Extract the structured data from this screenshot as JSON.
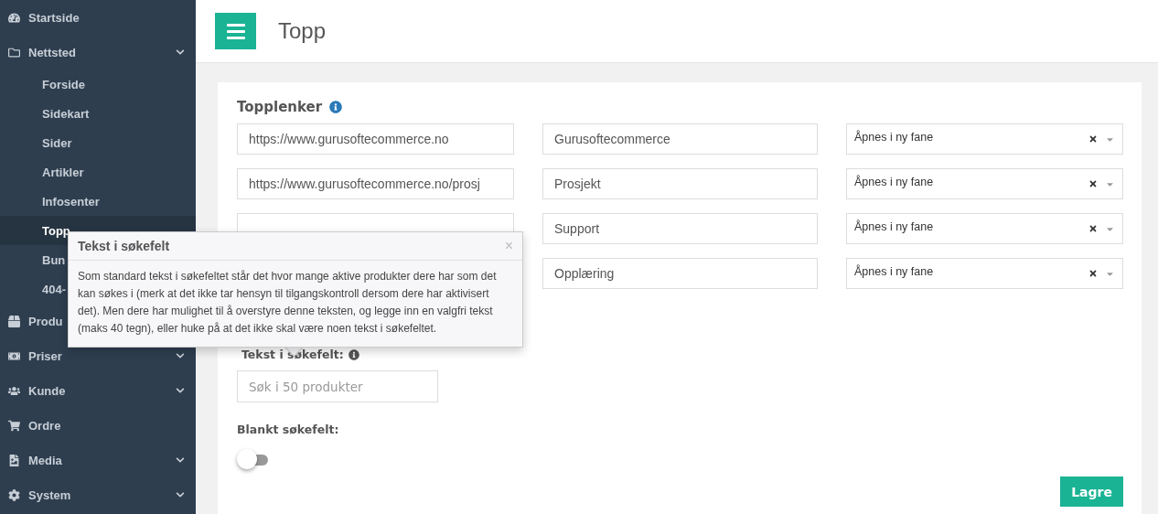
{
  "sidebar": {
    "items": [
      {
        "kind": "group",
        "label": "Startside",
        "expandable": false,
        "selected": false
      },
      {
        "kind": "group",
        "label": "Nettsted",
        "expandable": true,
        "selected": false,
        "children": [
          {
            "label": "Forside",
            "selected": false
          },
          {
            "label": "Sidekart",
            "selected": false
          },
          {
            "label": "Sider",
            "selected": false
          },
          {
            "label": "Artikler",
            "selected": false
          },
          {
            "label": "Infosenter",
            "selected": false
          },
          {
            "label": "Topp",
            "selected": true
          },
          {
            "label": "Bun",
            "selected": false
          },
          {
            "label": "404-",
            "selected": false
          }
        ]
      },
      {
        "kind": "group",
        "label": "Produ",
        "expandable": false,
        "selected": false
      },
      {
        "kind": "group",
        "label": "Priser",
        "expandable": true,
        "selected": false
      },
      {
        "kind": "group",
        "label": "Kunde",
        "expandable": true,
        "selected": false
      },
      {
        "kind": "group",
        "label": "Ordre",
        "expandable": false,
        "selected": false
      },
      {
        "kind": "group",
        "label": "Media",
        "expandable": true,
        "selected": false
      },
      {
        "kind": "group",
        "label": "System",
        "expandable": true,
        "selected": false
      }
    ]
  },
  "header": {
    "title": "Topp"
  },
  "topplenker": {
    "title": "Topplenker",
    "rows": [
      {
        "url": "https://www.gurusoftecommerce.no",
        "name": "Gurusoftecommerce",
        "target": "Åpnes i ny fane"
      },
      {
        "url": "https://www.gurusoftecommerce.no/prosj",
        "name": "Prosjekt",
        "target": "Åpnes i ny fane"
      },
      {
        "name": "Support",
        "target": "Åpnes i ny fane"
      },
      {
        "name": "Opplæring",
        "target": "Åpnes i ny fane"
      }
    ]
  },
  "search_text": {
    "label": "Tekst i søkefelt:",
    "placeholder": "Søk i 50 produkter"
  },
  "blank_search": {
    "label": "Blankt søkefelt:",
    "on": false
  },
  "save_button": "Lagre",
  "popover": {
    "title": "Tekst i søkefelt",
    "close": "×",
    "body": "Som standard tekst i søkefeltet står det hvor mange aktive produkter dere har som det kan søkes i (merk at det ikke tar hensyn til tilgangskontroll dersom dere har aktivisert det). Men dere har mulighet til å overstyre denne teksten, og legge inn en valgfri tekst (maks 40 tegn), eller huke på at det ikke skal være noen tekst i søkefeltet."
  }
}
